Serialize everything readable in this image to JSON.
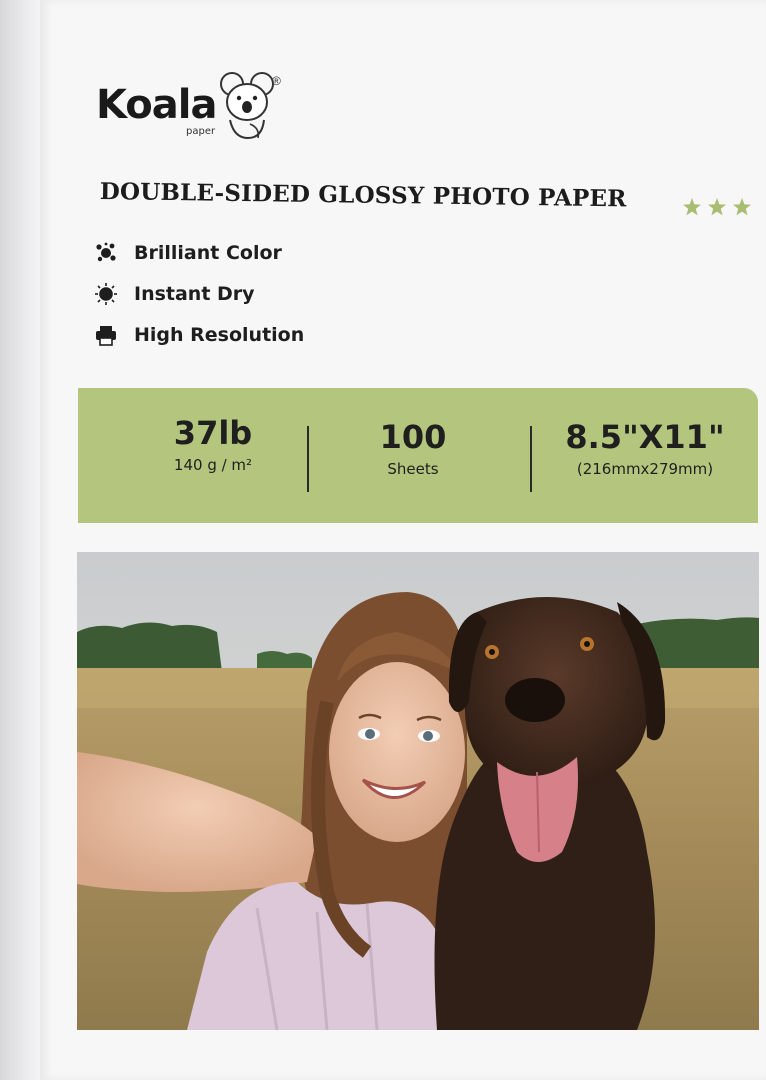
{
  "brand": {
    "name": "Koala",
    "sub": "paper",
    "registered": "®"
  },
  "product": {
    "title": "DOUBLE-SIDED GLOSSY PHOTO PAPER",
    "stars": 3
  },
  "features": [
    {
      "icon": "splash-icon",
      "label": "Brilliant Color"
    },
    {
      "icon": "sun-icon",
      "label": "Instant Dry"
    },
    {
      "icon": "printer-icon",
      "label": "High Resolution"
    }
  ],
  "specs": {
    "weight": {
      "value": "37lb",
      "detail": "140 g / m²"
    },
    "count": {
      "value": "100",
      "detail": "Sheets"
    },
    "size": {
      "value": "8.5\"X11\"",
      "detail": "(216mmx279mm)"
    }
  },
  "colors": {
    "accent": "#b4c67e",
    "star": "#a9bd72",
    "text": "#1e1e1e"
  },
  "photo": {
    "subject": "girl-and-dog-selfie-photo"
  }
}
